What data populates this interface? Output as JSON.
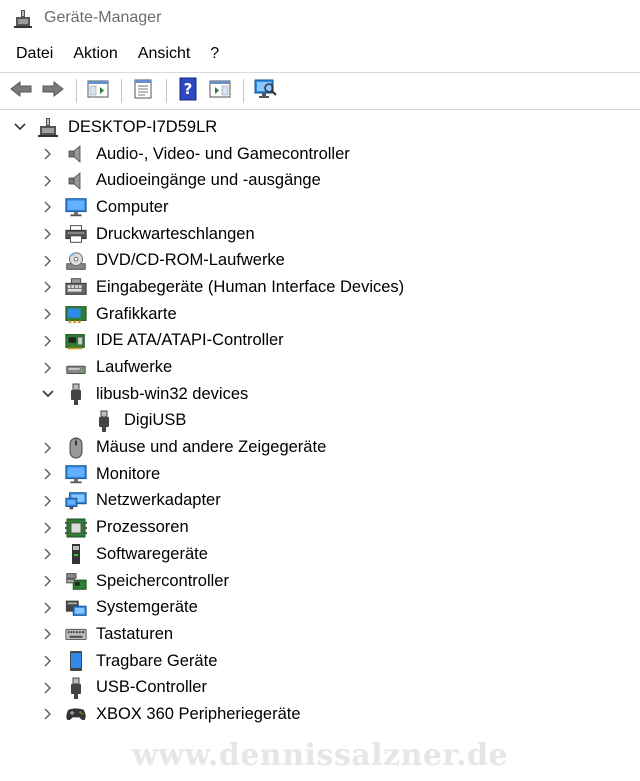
{
  "window": {
    "title": "Geräte-Manager"
  },
  "menu": [
    "Datei",
    "Aktion",
    "Ansicht",
    "?"
  ],
  "toolbar": [
    {
      "name": "back-button",
      "icon": "arrow-left-icon"
    },
    {
      "name": "forward-button",
      "icon": "arrow-right-icon"
    },
    {
      "sep": true
    },
    {
      "name": "show-hide-console-tree-button",
      "icon": "console-tree-icon"
    },
    {
      "sep": true
    },
    {
      "name": "properties-button",
      "icon": "properties-sheet-icon"
    },
    {
      "sep": true
    },
    {
      "name": "help-button",
      "icon": "help-icon"
    },
    {
      "name": "show-action-pane-button",
      "icon": "action-pane-icon"
    },
    {
      "sep": true
    },
    {
      "name": "scan-hardware-button",
      "icon": "monitor-scan-icon"
    }
  ],
  "tree": {
    "root": {
      "label": "DESKTOP-I7D59LR",
      "icon": "computer-network-icon",
      "expanded": true
    },
    "items": [
      {
        "label": "Audio-, Video- und Gamecontroller",
        "icon": "speaker-icon",
        "expanded": false
      },
      {
        "label": "Audioeingänge und -ausgänge",
        "icon": "speaker-icon",
        "expanded": false
      },
      {
        "label": "Computer",
        "icon": "monitor-icon",
        "expanded": false
      },
      {
        "label": "Druckwarteschlangen",
        "icon": "printer-icon",
        "expanded": false
      },
      {
        "label": "DVD/CD-ROM-Laufwerke",
        "icon": "dvd-drive-icon",
        "expanded": false
      },
      {
        "label": "Eingabegeräte (Human Interface Devices)",
        "icon": "hid-icon",
        "expanded": false
      },
      {
        "label": "Grafikkarte",
        "icon": "display-adapter-icon",
        "expanded": false
      },
      {
        "label": "IDE ATA/ATAPI-Controller",
        "icon": "ide-controller-icon",
        "expanded": false
      },
      {
        "label": "Laufwerke",
        "icon": "disk-drive-icon",
        "expanded": false
      },
      {
        "label": "libusb-win32 devices",
        "icon": "usb-plug-icon",
        "expanded": true,
        "children": [
          {
            "label": "DigiUSB",
            "icon": "usb-plug-icon"
          }
        ]
      },
      {
        "label": "Mäuse und andere Zeigegeräte",
        "icon": "mouse-icon",
        "expanded": false
      },
      {
        "label": "Monitore",
        "icon": "monitor-icon",
        "expanded": false
      },
      {
        "label": "Netzwerkadapter",
        "icon": "network-adapter-icon",
        "expanded": false
      },
      {
        "label": "Prozessoren",
        "icon": "processor-icon",
        "expanded": false
      },
      {
        "label": "Softwaregeräte",
        "icon": "software-device-icon",
        "expanded": false
      },
      {
        "label": "Speichercontroller",
        "icon": "storage-controller-icon",
        "expanded": false
      },
      {
        "label": "Systemgeräte",
        "icon": "system-devices-icon",
        "expanded": false
      },
      {
        "label": "Tastaturen",
        "icon": "keyboard-icon",
        "expanded": false
      },
      {
        "label": "Tragbare Geräte",
        "icon": "portable-device-icon",
        "expanded": false
      },
      {
        "label": "USB-Controller",
        "icon": "usb-plug-icon",
        "expanded": false
      },
      {
        "label": "XBOX 360 Peripheriegeräte",
        "icon": "gamepad-icon",
        "expanded": false
      }
    ]
  },
  "watermark": "www.dennissalzner.de",
  "colors": {
    "accent_blue": "#1e73c8",
    "monitor_blue": "#2e8ae6",
    "chip_green": "#2e7d32",
    "text_grey": "#6d6d6d"
  }
}
